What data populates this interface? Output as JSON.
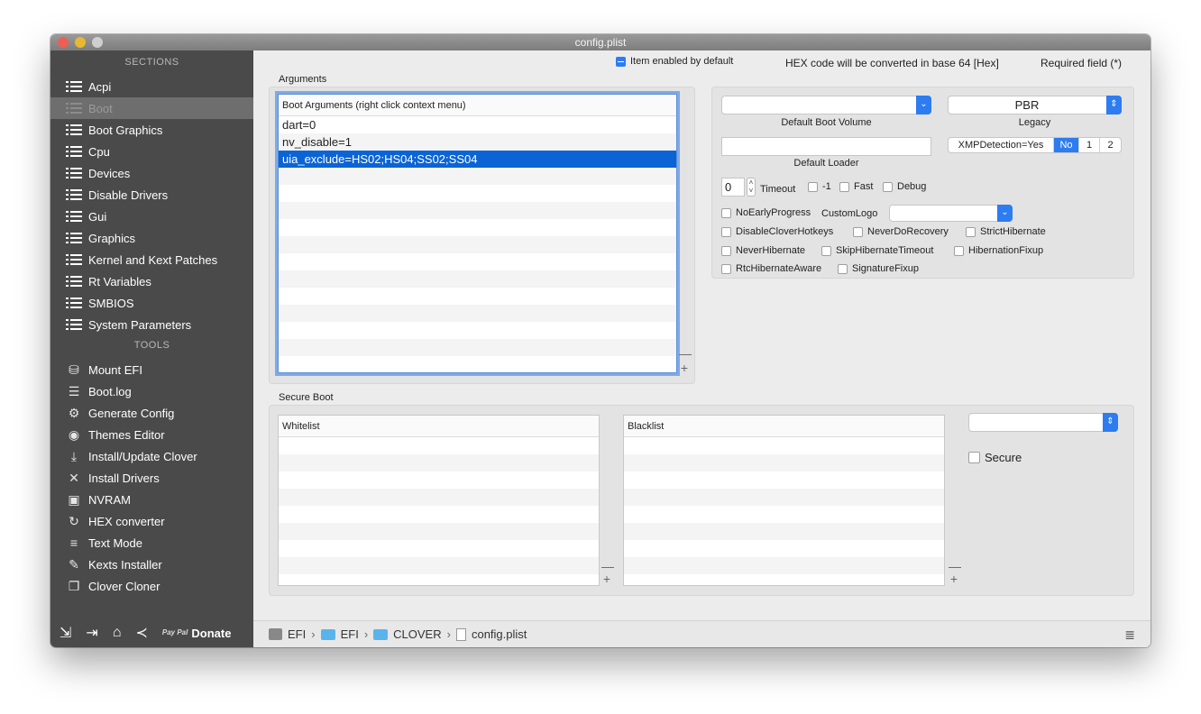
{
  "window": {
    "title": "config.plist"
  },
  "sidebar": {
    "sections_title": "SECTIONS",
    "sections": [
      {
        "label": "Acpi",
        "name": "sidebar-item-acpi"
      },
      {
        "label": "Boot",
        "name": "sidebar-item-boot"
      },
      {
        "label": "Boot Graphics",
        "name": "sidebar-item-boot-graphics"
      },
      {
        "label": "Cpu",
        "name": "sidebar-item-cpu"
      },
      {
        "label": "Devices",
        "name": "sidebar-item-devices"
      },
      {
        "label": "Disable Drivers",
        "name": "sidebar-item-disable-drivers"
      },
      {
        "label": "Gui",
        "name": "sidebar-item-gui"
      },
      {
        "label": "Graphics",
        "name": "sidebar-item-graphics"
      },
      {
        "label": "Kernel and Kext Patches",
        "name": "sidebar-item-kernel-and-kext-patches"
      },
      {
        "label": "Rt Variables",
        "name": "sidebar-item-rt-variables"
      },
      {
        "label": "SMBIOS",
        "name": "sidebar-item-smbios"
      },
      {
        "label": "System Parameters",
        "name": "sidebar-item-system-parameters"
      }
    ],
    "selected": "Boot",
    "tools_title": "TOOLS",
    "tools": [
      {
        "label": "Mount EFI",
        "icon": "disk-icon"
      },
      {
        "label": "Boot.log",
        "icon": "log-icon"
      },
      {
        "label": "Generate Config",
        "icon": "gears-icon"
      },
      {
        "label": "Themes Editor",
        "icon": "palette-icon"
      },
      {
        "label": "Install/Update Clover",
        "icon": "download-icon"
      },
      {
        "label": "Install Drivers",
        "icon": "tools-icon"
      },
      {
        "label": "NVRAM",
        "icon": "chip-icon"
      },
      {
        "label": "HEX converter",
        "icon": "refresh-icon"
      },
      {
        "label": "Text Mode",
        "icon": "text-icon"
      },
      {
        "label": "Kexts Installer",
        "icon": "kext-icon"
      },
      {
        "label": "Clover Cloner",
        "icon": "clone-icon"
      }
    ],
    "bottom": {
      "paypal": "Pay Pal",
      "donate": "Donate"
    }
  },
  "header": {
    "item_enabled": "Item enabled by default",
    "hex_note": "HEX code will be converted in base 64 [Hex]",
    "required": "Required field (*)"
  },
  "arguments": {
    "section_label": "Arguments",
    "table_header": "Boot Arguments (right click context menu)",
    "rows": [
      "dart=0",
      "nv_disable=1",
      "uia_exclude=HS02;HS04;SS02;SS04"
    ],
    "selected_index": 2
  },
  "boot_options": {
    "default_boot_volume_label": "Default Boot Volume",
    "default_boot_volume_value": "",
    "legacy_label": "Legacy",
    "legacy_value": "PBR",
    "default_loader_label": "Default Loader",
    "default_loader_value": "",
    "xmp_label": "XMPDetection=Yes",
    "xmp_options": [
      "No",
      "1",
      "2"
    ],
    "xmp_selected": "No",
    "timeout_value": "0",
    "timeout_label": "Timeout",
    "minus1_label": "-1",
    "fast_label": "Fast",
    "debug_label": "Debug",
    "no_early_progress": "NoEarlyProgress",
    "custom_logo_label": "CustomLogo",
    "custom_logo_value": "",
    "disable_clover_hotkeys": "DisableCloverHotkeys",
    "never_do_recovery": "NeverDoRecovery",
    "strict_hibernate": "StrictHibernate",
    "never_hibernate": "NeverHibernate",
    "skip_hibernate_timeout": "SkipHibernateTimeout",
    "hibernation_fixup": "HibernationFixup",
    "rtc_hibernate_aware": "RtcHibernateAware",
    "signature_fixup": "SignatureFixup"
  },
  "secure_boot": {
    "section_label": "Secure Boot",
    "whitelist_header": "Whitelist",
    "blacklist_header": "Blacklist",
    "policy_value": "",
    "secure_label": "Secure"
  },
  "pathbar": {
    "items": [
      "EFI",
      "EFI",
      "CLOVER",
      "config.plist"
    ]
  }
}
